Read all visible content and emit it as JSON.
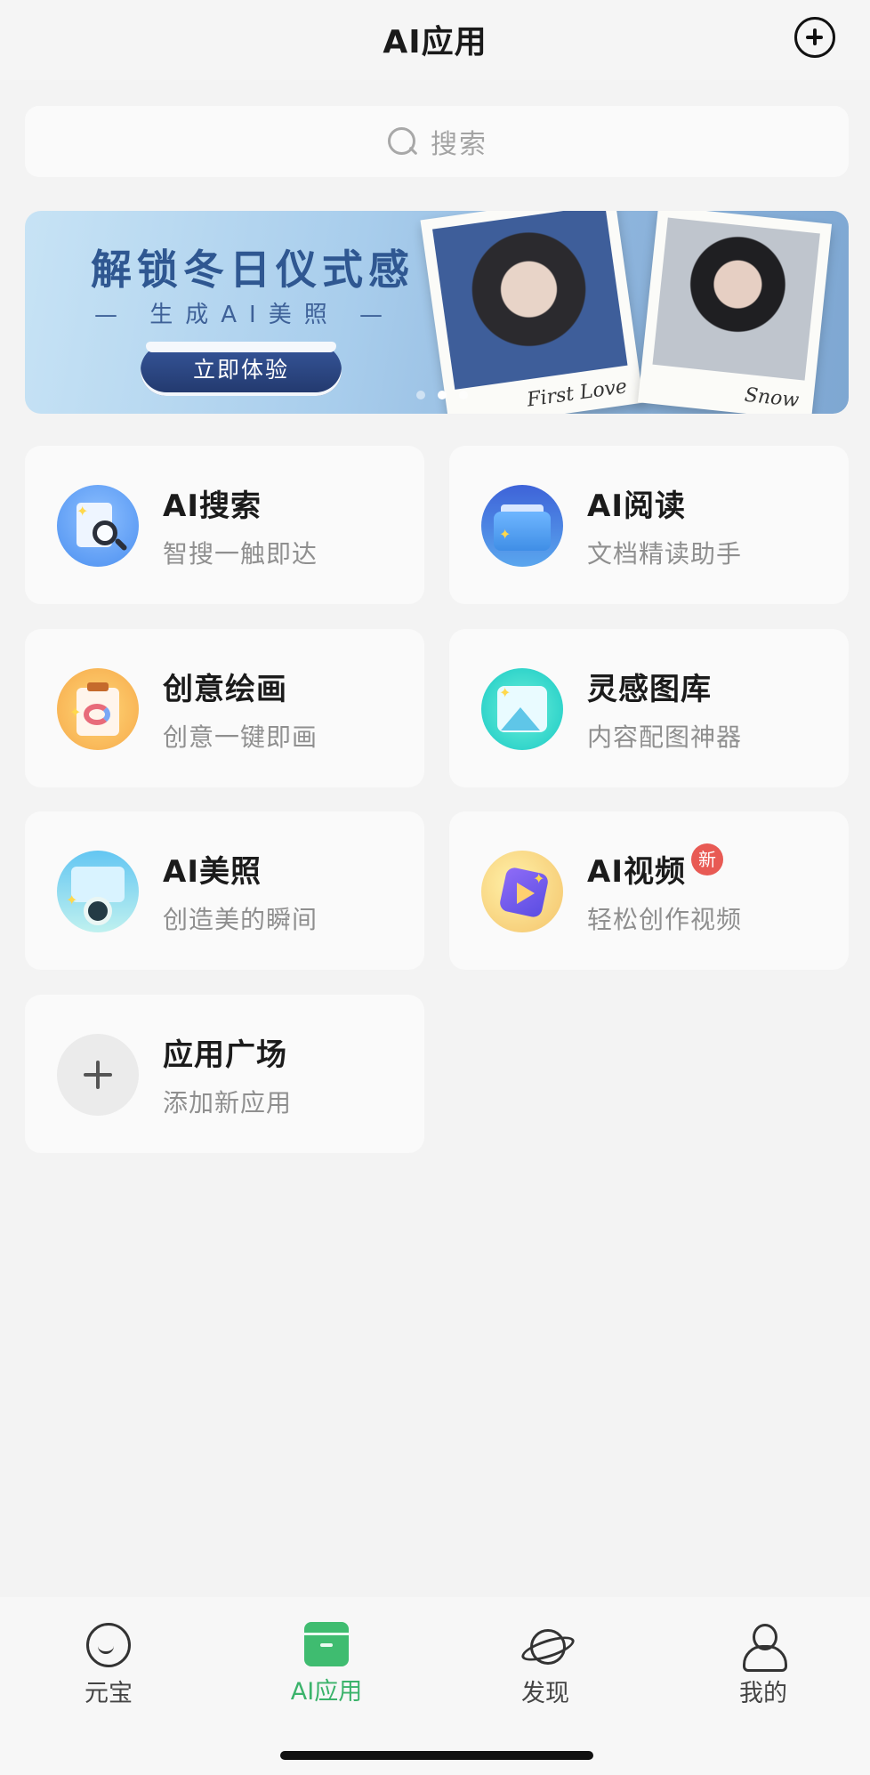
{
  "header": {
    "title": "AI应用"
  },
  "search": {
    "placeholder": "搜索"
  },
  "banner": {
    "headline": "解锁冬日仪式感",
    "subline": "— 生成AI美照 —",
    "cta": "立即体验",
    "photo_captions": [
      "First Love",
      "Snow"
    ],
    "page_count": 3,
    "active_page": 2
  },
  "apps": [
    {
      "name": "AI搜索",
      "desc": "智搜一触即达",
      "icon": "ai-search-icon"
    },
    {
      "name": "AI阅读",
      "desc": "文档精读助手",
      "icon": "ai-reading-icon"
    },
    {
      "name": "创意绘画",
      "desc": "创意一键即画",
      "icon": "creative-painting-icon"
    },
    {
      "name": "灵感图库",
      "desc": "内容配图神器",
      "icon": "inspiration-gallery-icon"
    },
    {
      "name": "AI美照",
      "desc": "创造美的瞬间",
      "icon": "ai-photo-icon"
    },
    {
      "name": "AI视频",
      "desc": "轻松创作视频",
      "icon": "ai-video-icon",
      "badge": "新"
    },
    {
      "name": "应用广场",
      "desc": "添加新应用",
      "icon": "plus-icon"
    }
  ],
  "tabbar": {
    "tabs": [
      {
        "label": "元宝",
        "icon": "chat-bubble-icon"
      },
      {
        "label": "AI应用",
        "icon": "app-box-icon",
        "active": true
      },
      {
        "label": "发现",
        "icon": "planet-icon"
      },
      {
        "label": "我的",
        "icon": "user-icon"
      }
    ]
  },
  "colors": {
    "accent": "#3bb36b",
    "badge": "#e85a54"
  }
}
